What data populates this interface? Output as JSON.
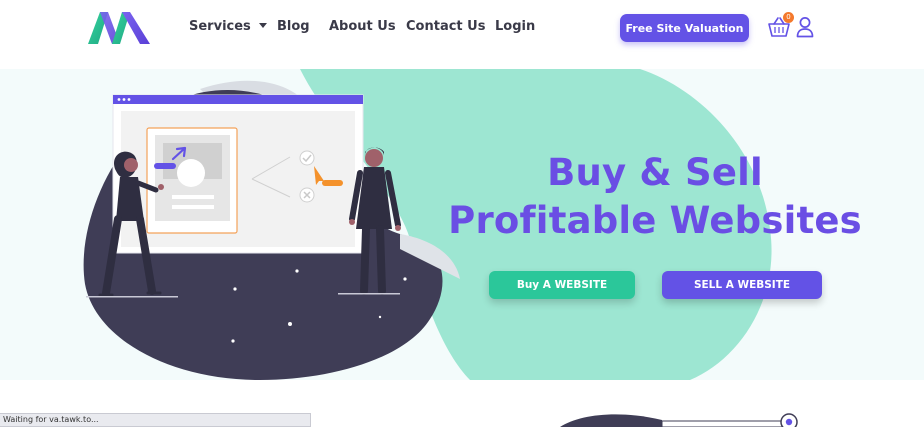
{
  "header": {
    "nav": [
      {
        "label": "Services",
        "has_dropdown": true
      },
      {
        "label": "Blog"
      },
      {
        "label": "About Us"
      },
      {
        "label": "Contact Us"
      },
      {
        "label": "Login"
      }
    ],
    "cta_label": "Free Site Valuation",
    "cart_count": "0",
    "icons": {
      "cart": "shopping-basket-icon",
      "user": "user-icon",
      "logo": "brand-logo"
    }
  },
  "hero": {
    "title_line1": "Buy & Sell",
    "title_line2": "Profitable Websites",
    "buy_button": "Buy A WEBSITE",
    "sell_button": "SELL A WEBSITE"
  },
  "status_bar": {
    "text": "Waiting for va.tawk.to..."
  },
  "colors": {
    "brand_purple": "#6352e6",
    "title_purple": "#6a4ee4",
    "mint_blob": "#9de6d2",
    "buy_green": "#2bc79a",
    "dark_blob": "#3f3d56",
    "accent_orange": "#f4792c"
  }
}
